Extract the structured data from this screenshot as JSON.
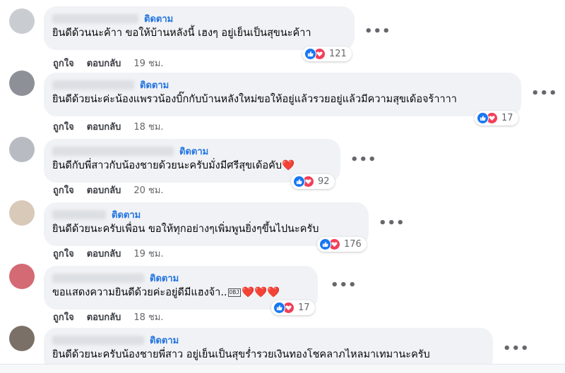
{
  "comments": [
    {
      "follow": "ติดตาม",
      "text": "ยินดีด้วนนะค้าา ขอให้บ้านหลังนี้ เฮงๆ อยู่เย็นเป็นสุขนะค้าา",
      "extra": "",
      "like_label": "ถูกใจ",
      "reply_label": "ตอบกลับ",
      "time": "19 ชม.",
      "reaction_count": "121"
    },
    {
      "follow": "ติดตาม",
      "text": "ยินดีด้วยน่ะค่ะน้องแพรวน้องบิ๊กกับบ้านหลังใหม่ขอให้อยู่แล้วรวยอยู่แล้วมีความสุขเด้อจร้าาาา",
      "extra": "",
      "like_label": "ถูกใจ",
      "reply_label": "ตอบกลับ",
      "time": "18 ชม.",
      "reaction_count": "17"
    },
    {
      "follow": "ติดตาม",
      "text": "ยินดีกับพี่สาวกับน้องชายด้วยนะครับมั่งมีศรีสุขเด้อคับ",
      "extra": "❤️",
      "like_label": "ถูกใจ",
      "reply_label": "ตอบกลับ",
      "time": "20 ชม.",
      "reaction_count": "92"
    },
    {
      "follow": "ติดตาม",
      "text": "ยินดีด้วยนะครับเพื่อน ขอให้ทุกอย่างๆเพิ่มพูนยิ่งๆขึ้นไปนะครับ",
      "extra": "",
      "like_label": "ถูกใจ",
      "reply_label": "ตอบกลับ",
      "time": "19 ชม.",
      "reaction_count": "176"
    },
    {
      "follow": "ติดตาม",
      "text": "ขอแสดงความยินดีด้วยค่ะอยู่ดีมีแฮงจ้า..",
      "extra": "❤️❤️❤️",
      "obj": "OBJ",
      "like_label": "ถูกใจ",
      "reply_label": "ตอบกลับ",
      "time": "18 ชม.",
      "reaction_count": "17"
    },
    {
      "follow": "ติดตาม",
      "text": "ยินดีด้วยนะครับน้องชายพี่สาว อยู่เย็นเป็นสุขร่ำรวยเงินทองโชคลาภไหลมาเทมานะครับ",
      "extra": "",
      "like_label": "",
      "reply_label": "",
      "time": "",
      "reaction_count": ""
    }
  ],
  "more_label": "•••",
  "colors": {
    "link": "#2374e1",
    "bubble": "#f0f2f5",
    "like": "#1877f2",
    "love": "#f33e58",
    "muted": "#65676b"
  },
  "icons": {
    "like": "thumbs-up-icon",
    "love": "heart-icon",
    "more": "more-horizontal-icon"
  }
}
